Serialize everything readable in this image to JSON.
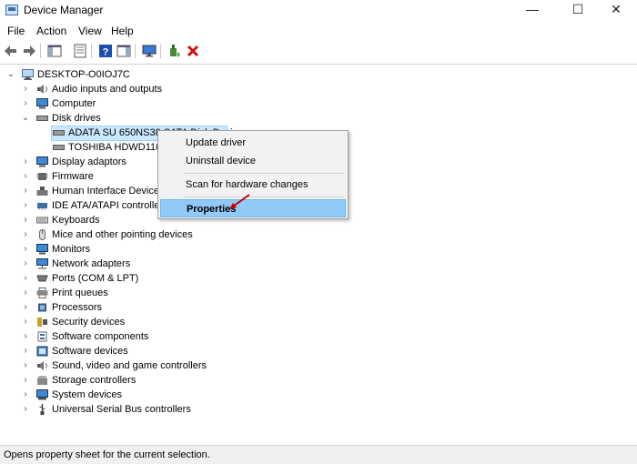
{
  "window": {
    "title": "Device Manager",
    "minimize_glyph": "—",
    "maximize_glyph": "☐",
    "close_glyph": "✕"
  },
  "menu": [
    "File",
    "Action",
    "View",
    "Help"
  ],
  "toolbar": {
    "icons": [
      "back-icon",
      "forward-icon",
      "show-hide-console-tree-icon",
      "properties-sheet-icon",
      "help-icon",
      "action-pane-icon",
      "scan-hardware-icon",
      "update-driver-icon",
      "uninstall-device-icon"
    ]
  },
  "tree": {
    "root": "DESKTOP-O0IOJ7C",
    "categories": [
      "Audio inputs and outputs",
      "Computer",
      "Disk drives",
      "Display adaptors",
      "Firmware",
      "Human Interface Device",
      "IDE ATA/ATAPI controller",
      "Keyboards",
      "Mice and other pointing devices",
      "Monitors",
      "Network adapters",
      "Ports (COM & LPT)",
      "Print queues",
      "Processors",
      "Security devices",
      "Software components",
      "Software devices",
      "Sound, video and game controllers",
      "Storage controllers",
      "System devices",
      "Universal Serial Bus controllers"
    ],
    "disk_children": [
      "ADATA SU 650NS38 SATA Disk Device",
      "TOSHIBA HDWD110"
    ]
  },
  "context_menu": {
    "update_driver": "Update driver",
    "uninstall_device": "Uninstall device",
    "scan_hardware": "Scan for hardware changes",
    "properties": "Properties"
  },
  "status": "Opens property sheet for the current selection.",
  "colors": {
    "selection": "#cce8ff",
    "menu_highlight": "#91c9f7",
    "arrow_annotation": "#c00000"
  }
}
